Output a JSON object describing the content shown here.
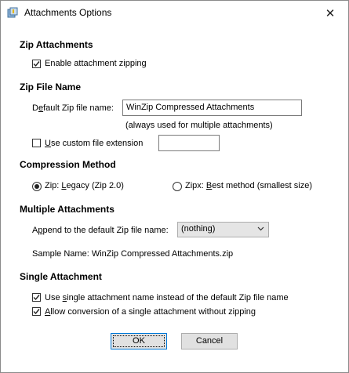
{
  "window": {
    "title": "Attachments Options",
    "close_glyph": "✕"
  },
  "zip_attachments": {
    "heading": "Zip Attachments",
    "enable_zipping": {
      "label": "Enable attachment zipping",
      "checked": true
    }
  },
  "zip_file_name": {
    "heading": "Zip File Name",
    "default_label_pre": "D",
    "default_label_ul": "e",
    "default_label_post": "fault Zip file name:",
    "default_value": "WinZip Compressed Attachments",
    "note": "(always used for multiple attachments)",
    "custom_ext_ul": "U",
    "custom_ext_post": "se custom file extension",
    "custom_ext_checked": false,
    "custom_ext_value": ""
  },
  "compression": {
    "heading": "Compression Method",
    "zip_pre": "Zip: ",
    "zip_ul": "L",
    "zip_post": "egacy (Zip 2.0)",
    "zip_selected": true,
    "zipx_pre": "Zipx: ",
    "zipx_ul": "B",
    "zipx_post": "est method (smallest size)",
    "zipx_selected": false
  },
  "multiple": {
    "heading": "Multiple Attachments",
    "append_pre": "A",
    "append_ul": "p",
    "append_post": "pend to the default Zip file name:",
    "append_value": "(nothing)",
    "sample_label": "Sample Name:",
    "sample_value": "WinZip Compressed Attachments.zip"
  },
  "single": {
    "heading": "Single Attachment",
    "use_single_pre": "Use ",
    "use_single_ul": "s",
    "use_single_post": "ingle attachment name instead of the default Zip file name",
    "use_single_checked": true,
    "allow_ul": "A",
    "allow_post": "llow conversion of a single attachment without zipping",
    "allow_checked": true
  },
  "buttons": {
    "ok": "OK",
    "cancel": "Cancel"
  }
}
